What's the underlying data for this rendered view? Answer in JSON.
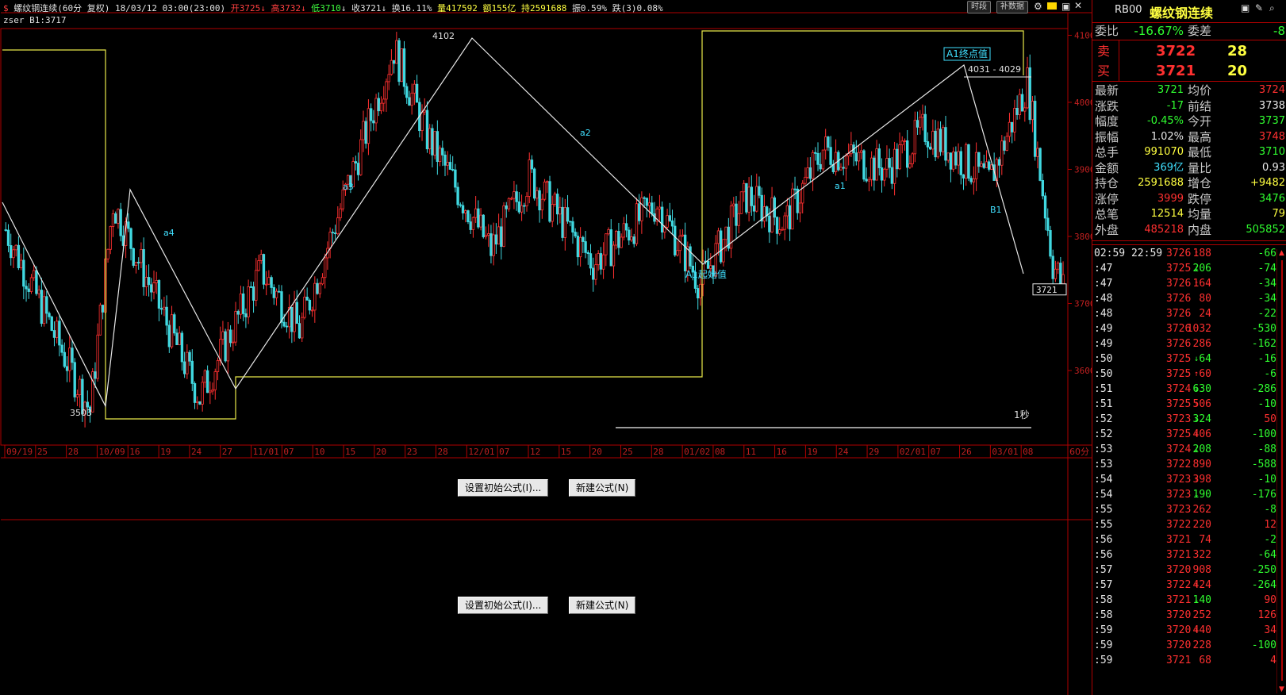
{
  "header": {
    "title": "螺纹钢连续(60分  复权)",
    "datetime": "18/03/12 03:00(23:00)",
    "open": "开3725",
    "high": "高3732",
    "low": "低3710",
    "close": "收3721",
    "turnover": "换16.11%",
    "volume": "量417592",
    "amount": "额155亿",
    "hold": "持2591688",
    "amplitude": "振0.59%",
    "fall": "跌(3)0.08%",
    "btn_timeshare": "时段",
    "btn_supplement": "补数据"
  },
  "indicator_line": "zser B1:3717",
  "chart_data": {
    "type": "candlestick",
    "x_ticks": [
      "09/19",
      "25",
      "28",
      "10/09",
      "16",
      "19",
      "24",
      "27",
      "11/01",
      "07",
      "10",
      "15",
      "20",
      "23",
      "28",
      "12/01",
      "07",
      "12",
      "15",
      "20",
      "25",
      "28",
      "01/02",
      "08",
      "11",
      "16",
      "19",
      "24",
      "29",
      "02/01",
      "07",
      "26",
      "03/01",
      "08"
    ],
    "x_unit": "60分",
    "y_ticks": [
      4100,
      4000,
      3900,
      3800,
      3700,
      3600
    ],
    "ylim": [
      3490,
      4110
    ],
    "last_price_tag": "3721",
    "zigzag_labels": {
      "high": "4102",
      "low": "3503",
      "a1": "a1",
      "a2": "a2",
      "a3": "a3",
      "a4": "a4",
      "b1": "B1",
      "a1_start": "A1起始值",
      "a1_end": "A1终点值",
      "range": "4031 - 4029",
      "period": "1秒"
    }
  },
  "subpanels": [
    {
      "btn_init": "设置初始公式(I)...",
      "btn_new": "新建公式(N)"
    },
    {
      "btn_init": "设置初始公式(I)...",
      "btn_new": "新建公式(N)"
    }
  ],
  "panel": {
    "code": "RB00",
    "name": "螺纹钢连续",
    "commission_ratio_label": "委比",
    "commission_ratio": "-16.67%",
    "commission_diff_label": "委差",
    "commission_diff": "-8",
    "sell_label": "卖",
    "sell_price": "3722",
    "sell_vol": "28",
    "buy_label": "买",
    "buy_price": "3721",
    "buy_vol": "20",
    "stats": [
      {
        "l1": "最新",
        "v1": "3721",
        "c1": "green",
        "l2": "均价",
        "v2": "3724",
        "c2": "red"
      },
      {
        "l1": "涨跌",
        "v1": "-17",
        "c1": "green",
        "l2": "前结",
        "v2": "3738",
        "c2": "white"
      },
      {
        "l1": "幅度",
        "v1": "-0.45%",
        "c1": "green",
        "l2": "今开",
        "v2": "3737",
        "c2": "green"
      },
      {
        "l1": "振幅",
        "v1": "1.02%",
        "c1": "white",
        "l2": "最高",
        "v2": "3748",
        "c2": "red"
      },
      {
        "l1": "总手",
        "v1": "991070",
        "c1": "yellow",
        "l2": "最低",
        "v2": "3710",
        "c2": "green"
      },
      {
        "l1": "金额",
        "v1": "369亿",
        "c1": "cyan",
        "l2": "量比",
        "v2": "0.93",
        "c2": "white"
      },
      {
        "l1": "持仓",
        "v1": "2591688",
        "c1": "yellow",
        "l2": "增仓",
        "v2": "+9482",
        "c2": "yellow"
      },
      {
        "l1": "涨停",
        "v1": "3999",
        "c1": "red",
        "l2": "跌停",
        "v2": "3476",
        "c2": "green"
      },
      {
        "l1": "总笔",
        "v1": "12514",
        "c1": "yellow",
        "l2": "均量",
        "v2": "79",
        "c2": "yellow"
      },
      {
        "l1": "外盘",
        "v1": "485218",
        "c1": "red",
        "l2": "内盘",
        "v2": "505852",
        "c2": "green"
      }
    ],
    "ticks": [
      {
        "t": "02:59 22:59",
        "p": "3726",
        "a": "↑",
        "v": "188",
        "d": "-66"
      },
      {
        "t": ":47",
        "p": "3725",
        "a": "↓",
        "v": "206",
        "d": "-74"
      },
      {
        "t": ":47",
        "p": "3726",
        "a": "↑",
        "v": "164",
        "d": "-34"
      },
      {
        "t": ":48",
        "p": "3726",
        "a": "",
        "v": "80",
        "d": "-34"
      },
      {
        "t": ":48",
        "p": "3726",
        "a": "",
        "v": "24",
        "d": "-22"
      },
      {
        "t": ":49",
        "p": "3726",
        "a": "",
        "v": "1032",
        "d": "-530"
      },
      {
        "t": ":49",
        "p": "3726",
        "a": "",
        "v": "286",
        "d": "-162"
      },
      {
        "t": ":50",
        "p": "3725",
        "a": "↓",
        "v": "64",
        "d": "-16"
      },
      {
        "t": ":50",
        "p": "3725",
        "a": "↑",
        "v": "60",
        "d": "-6"
      },
      {
        "t": ":51",
        "p": "3724",
        "a": "↓",
        "v": "630",
        "d": "-286"
      },
      {
        "t": ":51",
        "p": "3725",
        "a": "↑",
        "v": "506",
        "d": "-10"
      },
      {
        "t": ":52",
        "p": "3723",
        "a": "↓",
        "v": "324",
        "d": "50"
      },
      {
        "t": ":52",
        "p": "3725",
        "a": "↑",
        "v": "406",
        "d": "-100"
      },
      {
        "t": ":53",
        "p": "3724",
        "a": "↓",
        "v": "208",
        "d": "-88"
      },
      {
        "t": ":53",
        "p": "3722",
        "a": "",
        "v": "890",
        "d": "-588"
      },
      {
        "t": ":54",
        "p": "3723",
        "a": "↑",
        "v": "398",
        "d": "-10"
      },
      {
        "t": ":54",
        "p": "3723",
        "a": "↓",
        "v": "190",
        "d": "-176"
      },
      {
        "t": ":55",
        "p": "3723",
        "a": "",
        "v": "262",
        "d": "-8"
      },
      {
        "t": ":55",
        "p": "3722",
        "a": "",
        "v": "220",
        "d": "12"
      },
      {
        "t": ":56",
        "p": "3721",
        "a": "",
        "v": "74",
        "d": "-2"
      },
      {
        "t": ":56",
        "p": "3721",
        "a": "",
        "v": "322",
        "d": "-64"
      },
      {
        "t": ":57",
        "p": "3720",
        "a": "",
        "v": "908",
        "d": "-250"
      },
      {
        "t": ":57",
        "p": "3722",
        "a": "↑",
        "v": "424",
        "d": "-264"
      },
      {
        "t": ":58",
        "p": "3721",
        "a": "↓",
        "v": "140",
        "d": "90"
      },
      {
        "t": ":58",
        "p": "3720",
        "a": "",
        "v": "252",
        "d": "126"
      },
      {
        "t": ":59",
        "p": "3720",
        "a": "↑",
        "v": "440",
        "d": "34"
      },
      {
        "t": ":59",
        "p": "3720",
        "a": "",
        "v": "228",
        "d": "-100"
      },
      {
        "t": ":59",
        "p": "3721",
        "a": "",
        "v": "68",
        "d": "4"
      }
    ]
  }
}
